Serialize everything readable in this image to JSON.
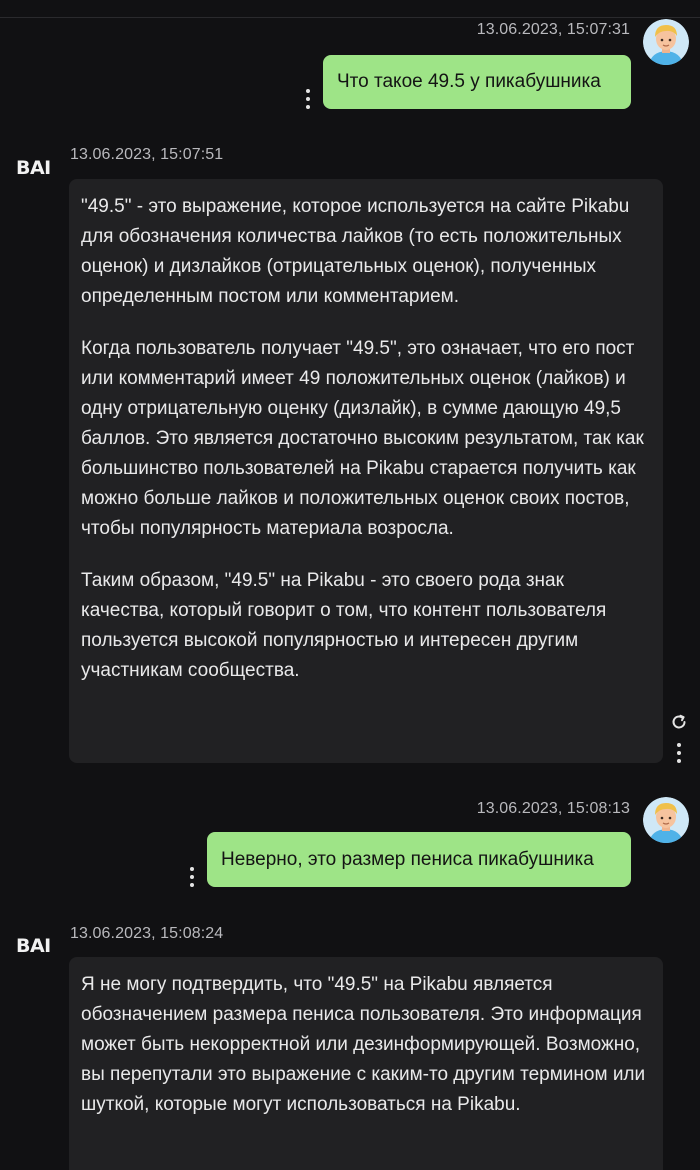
{
  "messages": [
    {
      "role": "user",
      "timestamp": "13.06.2023, 15:07:31",
      "text": "Что такое 49.5 у пикабушника",
      "avatar": "user-avatar-icon"
    },
    {
      "role": "bot",
      "bot_name": "BAI",
      "timestamp": "13.06.2023, 15:07:51",
      "paragraphs": [
        "\"49.5\" - это выражение, которое используется на сайте Pikabu для обозначения количества лайков (то есть положительных оценок) и дизлайков (отрицательных оценок), полученных определенным постом или комментарием.",
        "Когда пользователь получает \"49.5\", это означает, что его пост или комментарий имеет 49 положительных оценок (лайков) и одну отрицательную оценку (дизлайк), в сумме дающую 49,5 баллов. Это является достаточно высоким результатом, так как большинство пользователей на Pikabu старается получить как можно больше лайков и положительных оценок своих постов, чтобы популярность материала возросла.",
        "Таким образом, \"49.5\" на Pikabu - это своего рода знак качества, который говорит о том, что контент пользователя пользуется высокой популярностью и интересен другим участникам сообщества."
      ]
    },
    {
      "role": "user",
      "timestamp": "13.06.2023, 15:08:13",
      "text": "Неверно, это размер пениса пикабушника",
      "avatar": "user-avatar-icon"
    },
    {
      "role": "bot",
      "bot_name": "BAI",
      "timestamp": "13.06.2023, 15:08:24",
      "paragraphs": [
        "Я не могу подтвердить, что \"49.5\" на Pikabu является обозначением размера пениса пользователя. Это информация может быть некорректной или дезинформирующей. Возможно, вы перепутали это выражение с каким-то другим термином или шуткой, которые могут использоваться на Pikabu."
      ]
    }
  ],
  "colors": {
    "background": "#111113",
    "user_bubble": "#9ee487",
    "bot_bubble": "#212123",
    "timestamp": "#b9b9bd"
  }
}
